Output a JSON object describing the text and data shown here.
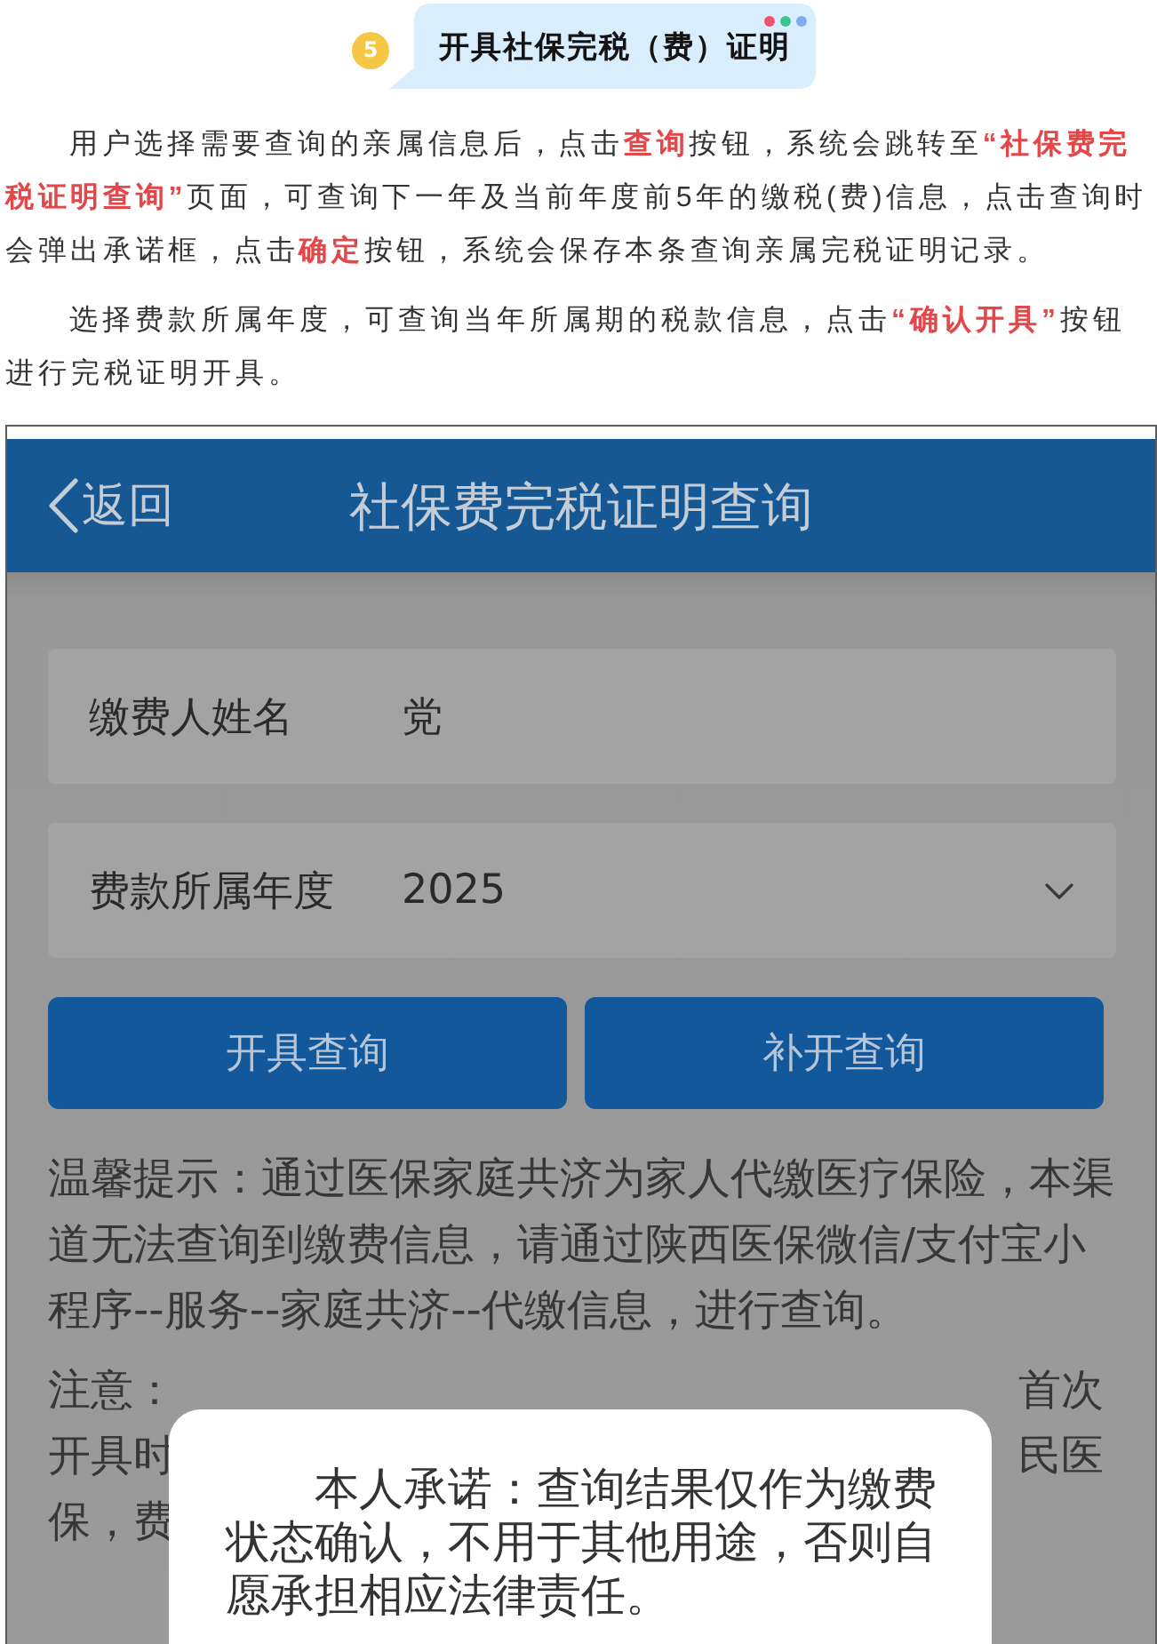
{
  "section_header": {
    "number": "5",
    "title": "开具社保完税（费）证明"
  },
  "paragraphs": [
    "用户选择需要查询的亲属信息后，点击**查询**按钮，系统会跳转至**“社保费完税证明查询”**页面，可查询下一年及当前年度前5年的缴税(费)信息，点击查询时会弹出承诺框，点击**确定**按钮，系统会保存本条查询亲属完税证明记录。",
    "选择费款所属年度，可查询当年所属期的税款信息，点击**“确认开具”**按钮进行完税证明开具。"
  ],
  "screenshot": {
    "nav_bar": {
      "back": "返回",
      "title": "社保费完税证明查询"
    },
    "fields": [
      {
        "kind": "text",
        "label": "缴费人姓名",
        "value": "党"
      },
      {
        "kind": "select",
        "label": "费款所属年度",
        "value": "2025"
      }
    ],
    "buttons": [
      "开具查询",
      "补开查询"
    ],
    "hint": "温馨提示：通过医保家庭共济为家人代缴医疗保险，本渠道无法查询到缴费信息，请通过陕西医保微信/支付宝小程序--服务--家庭共济--代缴信息，进行查询。",
    "note_fragments": [
      {
        "left": "注意：",
        "right": "首次"
      },
      {
        "left": "开具时",
        "right": "民医"
      },
      {
        "left": "保，费"
      }
    ],
    "dialog": {
      "message": "本人承诺：查询结果仅作为缴费状态确认，不用于其他用途，否则自愿承担相应法律责任。"
    }
  }
}
